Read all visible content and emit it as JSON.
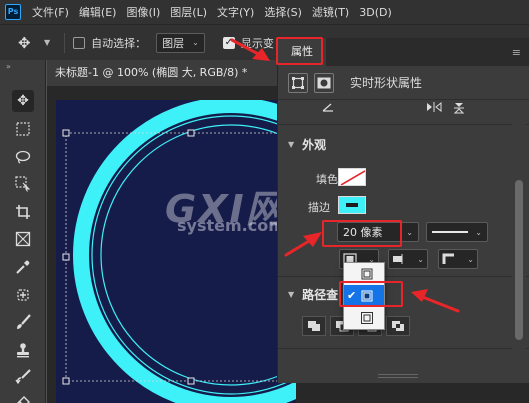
{
  "menubar": {
    "app_logo": "Ps",
    "items": [
      "文件(F)",
      "编辑(E)",
      "图像(I)",
      "图层(L)",
      "文字(Y)",
      "选择(S)",
      "滤镜(T)",
      "3D(D)"
    ]
  },
  "options_bar": {
    "auto_select_label": "自动选择：",
    "layer_dropdown": "图层",
    "show_transform_label": "显示变"
  },
  "document_tab": {
    "title": "未标题-1 @ 100% (椭圆 大, RGB/8) *"
  },
  "properties_panel": {
    "tab_label": "属性",
    "header_title": "实时形状属性",
    "appearance_section": "外观",
    "fill_label": "填色",
    "stroke_label": "描边",
    "stroke_width_value": "20 像素",
    "path_ops_section": "路径查"
  },
  "watermark": {
    "logo_text": "GXI网",
    "domain_text": "system.com"
  },
  "colors": {
    "ring_color": "#3ef0f8",
    "canvas_color": "#151c4a",
    "highlight_red": "#e8262a",
    "selection_blue": "#1473e6"
  },
  "icons": {
    "move_tool": "move-icon",
    "marquee_tool": "rect-marquee-icon",
    "lasso_tool": "lasso-icon",
    "object_select_tool": "object-select-icon",
    "crop_tool": "crop-icon",
    "frame_tool": "frame-icon",
    "eyedropper_tool": "eyedropper-icon",
    "healing_tool": "healing-icon",
    "brush_tool": "brush-icon",
    "stamp_tool": "stamp-icon",
    "history_brush_tool": "history-brush-icon",
    "eraser_tool": "eraser-icon"
  }
}
